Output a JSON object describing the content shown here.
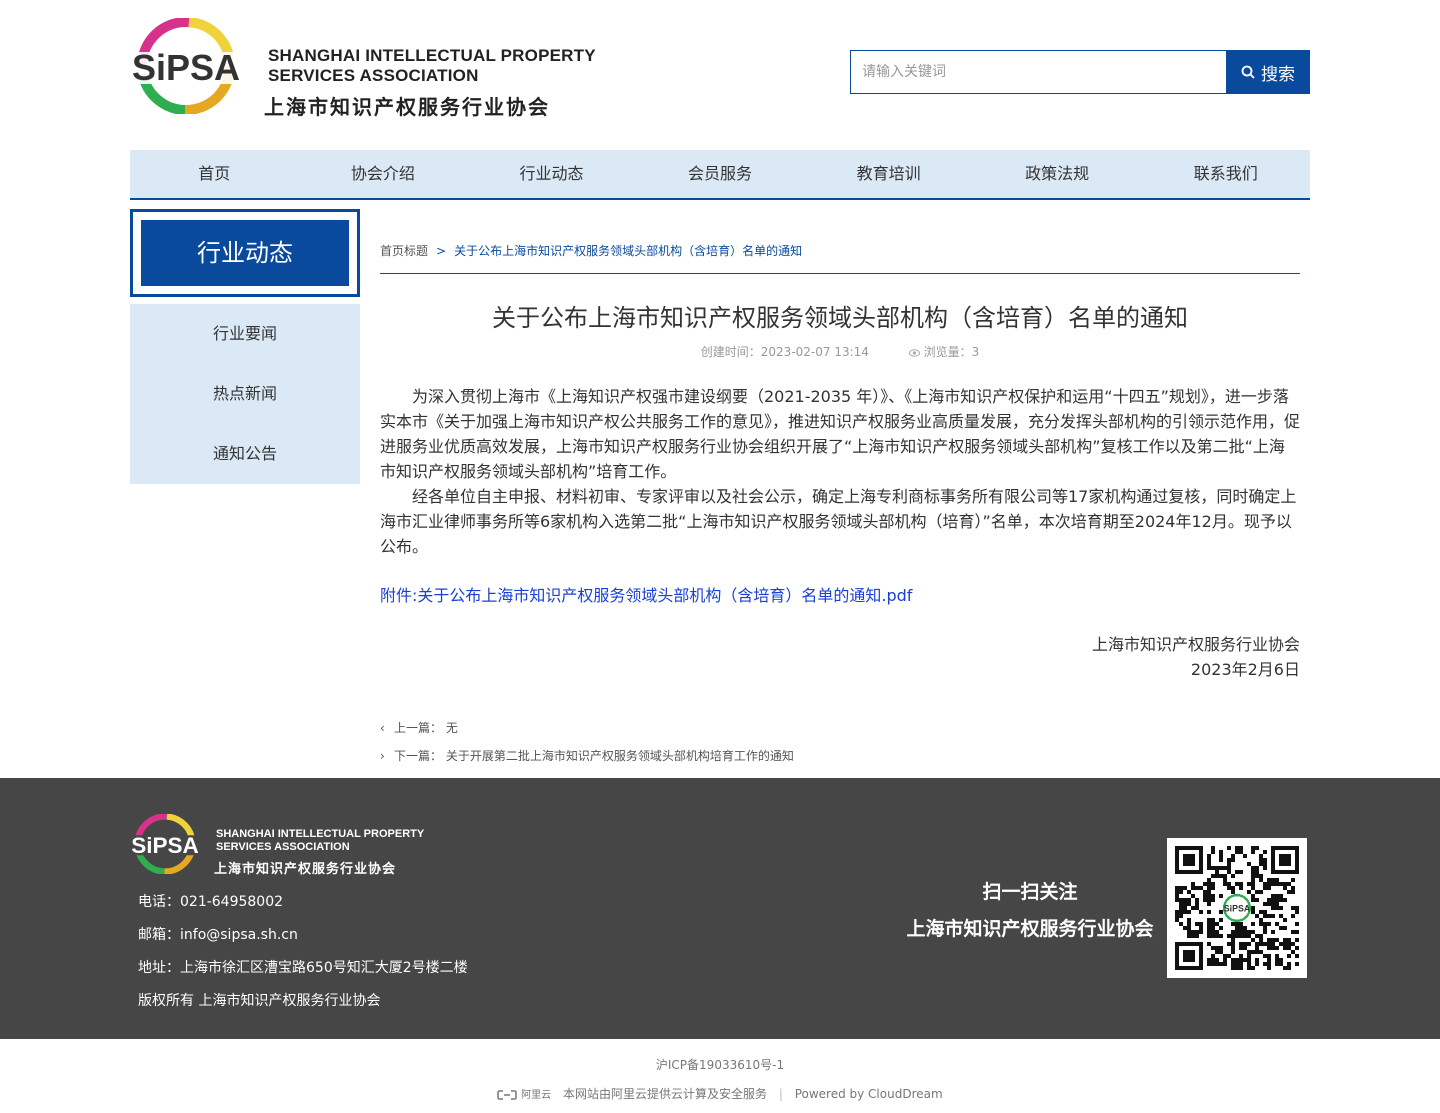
{
  "header": {
    "logo_text": "SiPSA",
    "logo_en_line1": "SHANGHAI INTELLECTUAL PROPERTY",
    "logo_en_line2": "SERVICES ASSOCIATION",
    "logo_cn": "上海市知识产权服务行业协会",
    "search_placeholder": "请输入关键词",
    "search_button": "搜索"
  },
  "nav": [
    "首页",
    "协会介绍",
    "行业动态",
    "会员服务",
    "教育培训",
    "政策法规",
    "联系我们"
  ],
  "sidebar": {
    "title": "行业动态",
    "items": [
      "行业要闻",
      "热点新闻",
      "通知公告"
    ]
  },
  "breadcrumb": {
    "home": "首页标题",
    "separator": ">",
    "current": "关于公布上海市知识产权服务领域头部机构（含培育）名单的通知"
  },
  "article": {
    "title": "关于公布上海市知识产权服务领域头部机构（含培育）名单的通知",
    "created": "创建时间：2023-02-07 13:14",
    "views": "浏览量：3",
    "paragraphs": [
      "为深入贯彻上海市《上海知识产权强市建设纲要（2021-2035 年）》、《上海市知识产权保护和运用“十四五”规划》，进一步落实本市《关于加强上海市知识产权公共服务工作的意见》，推进知识产权服务业高质量发展，充分发挥头部机构的引领示范作用，促进服务业优质高效发展，上海市知识产权服务行业协会组织开展了“上海市知识产权服务领域头部机构”复核工作以及第二批“上海市知识产权服务领域头部机构”培育工作。",
      "经各单位自主申报、材料初审、专家评审以及社会公示，确定上海专利商标事务所有限公司等17家机构通过复核，同时确定上海市汇业律师事务所等6家机构入选第二批“上海市知识产权服务领域头部机构（培育）”名单，本次培育期至2024年12月。现予以公布。"
    ],
    "attachment": "附件:关于公布上海市知识产权服务领域头部机构（含培育）名单的通知.pdf",
    "sign_org": "上海市知识产权服务行业协会",
    "sign_date": "2023年2月6日",
    "prev": "上一篇： 无",
    "next": "下一篇： 关于开展第二批上海市知识产权服务领域头部机构培育工作的通知"
  },
  "footer": {
    "logo_text": "SiPSA",
    "logo_en_line1": "SHANGHAI INTELLECTUAL PROPERTY",
    "logo_en_line2": "SERVICES ASSOCIATION",
    "logo_cn": "上海市知识产权服务行业协会",
    "phone": "电话：021-64958002",
    "email": "邮箱：info@sipsa.sh.cn",
    "address": "地址：上海市徐汇区漕宝路650号知汇大厦2号楼二楼",
    "copyright": "版权所有 上海市知识产权服务行业协会",
    "scan_line1": "扫一扫关注",
    "scan_line2": "上海市知识产权服务行业协会",
    "qr_badge": "SiPSA"
  },
  "bottom": {
    "icp": "沪ICP备19033610号-1",
    "aliyun_logo": "阿里云",
    "aliyun_text": "本网站由阿里云提供云计算及安全服务",
    "powered": "Powered by CloudDream"
  },
  "colors": {
    "primary": "#0a4a9c",
    "nav_bg": "#dbe9f6",
    "footer_bg": "#464646",
    "link": "#1a3fd8"
  },
  "icons": [
    "search-icon",
    "eye-icon",
    "chevron-left-icon",
    "chevron-right-icon",
    "qr-code",
    "aliyun-logo-icon"
  ]
}
